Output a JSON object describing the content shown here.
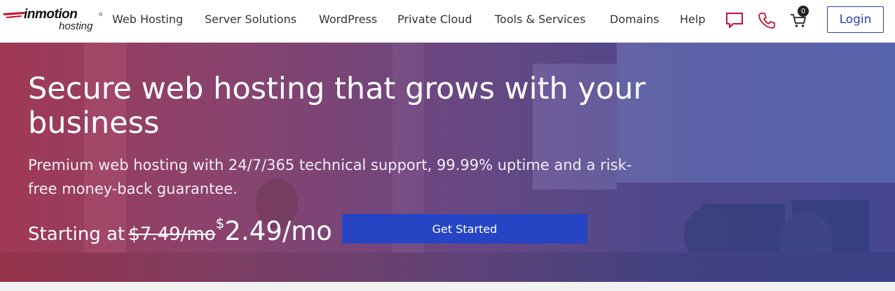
{
  "logo": {
    "brand": "inmotion",
    "sub": "hosting",
    "mark": "®"
  },
  "nav": {
    "items": [
      "Web Hosting",
      "Server Solutions",
      "WordPress",
      "Private Cloud",
      "Tools & Services",
      "Domains",
      "Help"
    ],
    "chat_icon": "chat-icon",
    "phone_icon": "phone-icon",
    "cart_icon": "cart-icon",
    "cart_count": "0",
    "login_label": "Login"
  },
  "hero": {
    "title": "Secure web hosting that grows with your business",
    "subtitle": "Premium web hosting with 24/7/365 technical support, 99.99% uptime and a risk-free money-back guarantee.",
    "starting_label": "Starting at",
    "old_price": "$7.49/mo",
    "currency": "$",
    "new_price": "2.49/mo",
    "cta_label": "Get Started"
  },
  "colors": {
    "brand_red": "#c8102e",
    "brand_blue": "#2541b2",
    "cta_blue": "#2545c4"
  }
}
